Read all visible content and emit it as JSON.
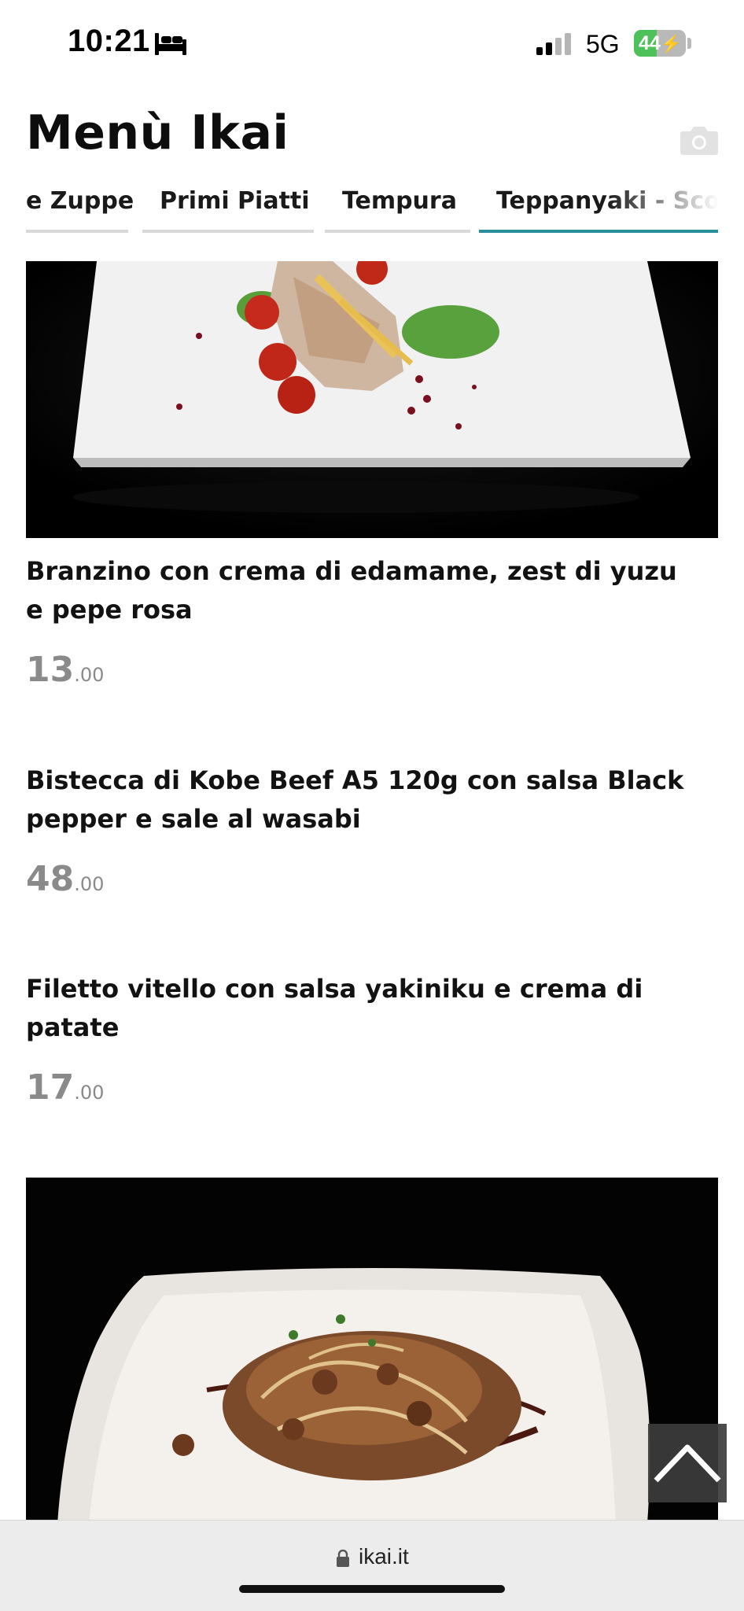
{
  "status_bar": {
    "time": "10:21",
    "network": "5G",
    "battery_level": "44",
    "battery_fraction": 0.44,
    "icons": [
      "bed-icon",
      "signal-icon",
      "battery-charging-icon"
    ]
  },
  "header": {
    "title": "Menù Ikai",
    "camera_icon": "camera-icon"
  },
  "tabs": [
    {
      "label": "e Zuppe",
      "active": false
    },
    {
      "label": "Primi Piatti",
      "active": false
    },
    {
      "label": "Tempura",
      "active": false
    },
    {
      "label": "Teppanyaki - Scott",
      "active": true
    }
  ],
  "items": [
    {
      "name": "Branzino con crema di edamame, zest di yuzu e pepe rosa",
      "price_int": "13",
      "price_dec": ".00"
    },
    {
      "name": "Bistecca di Kobe Beef A5 120g con salsa Black pepper e sale al wasabi",
      "price_int": "48",
      "price_dec": ".00"
    },
    {
      "name": "Filetto vitello con salsa yakiniku e crema di patate",
      "price_int": "17",
      "price_dec": ".00"
    }
  ],
  "browser": {
    "url": "ikai.it",
    "lock_icon": "lock-icon"
  },
  "colors": {
    "accent_tab": "#2a8e9c",
    "price_gray": "#8a8a8a",
    "battery_green": "#4fc15b"
  }
}
